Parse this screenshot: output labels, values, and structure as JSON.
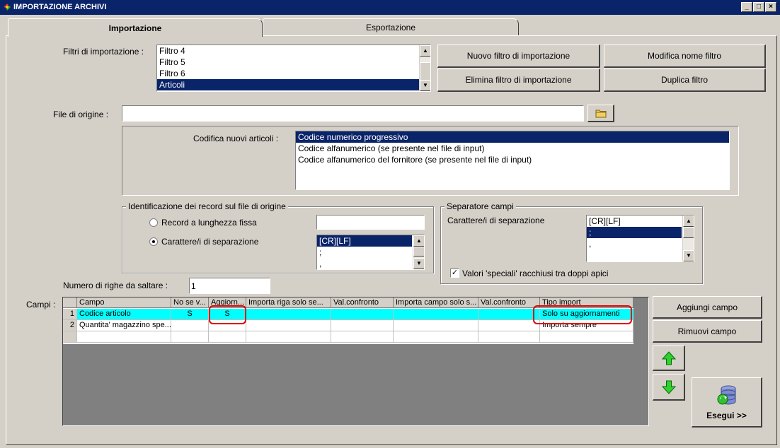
{
  "window": {
    "title": "IMPORTAZIONE ARCHIVI",
    "min": "_",
    "max": "□",
    "close": "×"
  },
  "tabs": [
    {
      "label": "Importazione"
    },
    {
      "label": "Esportazione"
    }
  ],
  "filters": {
    "label": "Filtri di importazione :",
    "items": [
      "Filtro 4",
      "Filtro 5",
      "Filtro 6",
      "Articoli"
    ]
  },
  "buttons": {
    "new_filter": "Nuovo filtro di importazione",
    "rename_filter": "Modifica nome filtro",
    "delete_filter": "Elimina filtro di importazione",
    "duplicate_filter": "Duplica filtro",
    "add_field": "Aggiungi campo",
    "remove_field": "Rimuovi campo",
    "run": "Esegui >>"
  },
  "source_file": {
    "label": "File di origine :",
    "value": ""
  },
  "coding": {
    "label": "Codifica nuovi articoli :",
    "items": [
      "Codice numerico progressivo",
      "Codice alfanumerico (se presente nel file di input)",
      "Codice alfanumerico del fornitore (se presente nel file di input)"
    ]
  },
  "record_id": {
    "title": "Identificazione dei record sul file di origine",
    "fixed_length": "Record a lunghezza fissa",
    "separator": "Carattere/i di separazione",
    "fixed_value": "",
    "separator_items": [
      "[CR][LF]",
      ";",
      ","
    ]
  },
  "field_sep": {
    "title": "Separatore campi",
    "label": "Carattere/i di separazione",
    "items": [
      "[CR][LF]",
      ";",
      ",",
      ""
    ],
    "quotes_label": "Valori 'speciali' racchiusi tra doppi apici",
    "quotes_checked": "✓"
  },
  "skip_rows": {
    "label": "Numero di righe da saltare  :",
    "value": "1"
  },
  "fields": {
    "label": "Campi :",
    "headers": [
      "Campo",
      "No se v...",
      "Aggiorn...",
      "Importa riga solo se...",
      "Val.confronto",
      "Importa campo solo s...",
      "Val.confronto",
      "Tipo import"
    ],
    "rows": [
      [
        "1",
        "Codice articolo",
        "S",
        "S",
        "",
        "",
        "",
        "",
        "Solo su aggiornamenti"
      ],
      [
        "2",
        "Quantita' magazzino spe...",
        "",
        "",
        "",
        "",
        "",
        "",
        "Importa sempre"
      ]
    ]
  }
}
